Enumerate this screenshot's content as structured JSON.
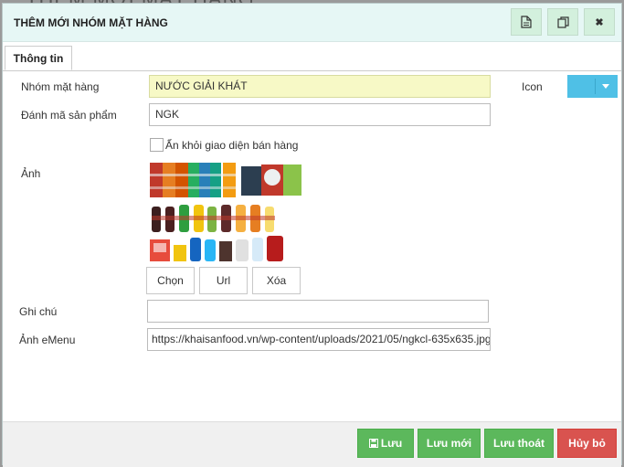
{
  "background": {
    "title": "THÊM MỚI MẶT HÀNG"
  },
  "dialog": {
    "title": "THÊM MỚI NHÓM MẶT HÀNG",
    "header_buttons": [
      {
        "icon": "document-icon"
      },
      {
        "icon": "copy-icon"
      },
      {
        "icon": "close-icon",
        "glyph": "✖"
      }
    ]
  },
  "tabs": [
    {
      "label": "Thông tin"
    }
  ],
  "form": {
    "group_label": "Nhóm mặt hàng",
    "group_value": "NƯỚC GIẢI KHÁT",
    "code_label": "Đánh mã sản phẩm",
    "code_value": "NGK",
    "hide_label": "Ẩn khỏi giao diện bán hàng",
    "image_label": "Ảnh",
    "icon_label": "Icon",
    "icon_color": "#4fc0e6",
    "image_buttons": {
      "choose": "Chọn",
      "url": "Url",
      "delete": "Xóa"
    },
    "note_label": "Ghi chú",
    "note_value": "",
    "emenu_label": "Ảnh eMenu",
    "emenu_value": "https://khaisanfood.vn/wp-content/uploads/2021/05/ngkcl-635x635.jpg"
  },
  "footer": {
    "save_label": "Lưu",
    "save_new_label": "Lưu mới",
    "save_exit_label": "Lưu thoát",
    "cancel_label": "Hủy bỏ",
    "colors": {
      "green": "#5cb85c",
      "red": "#d9534f"
    }
  }
}
